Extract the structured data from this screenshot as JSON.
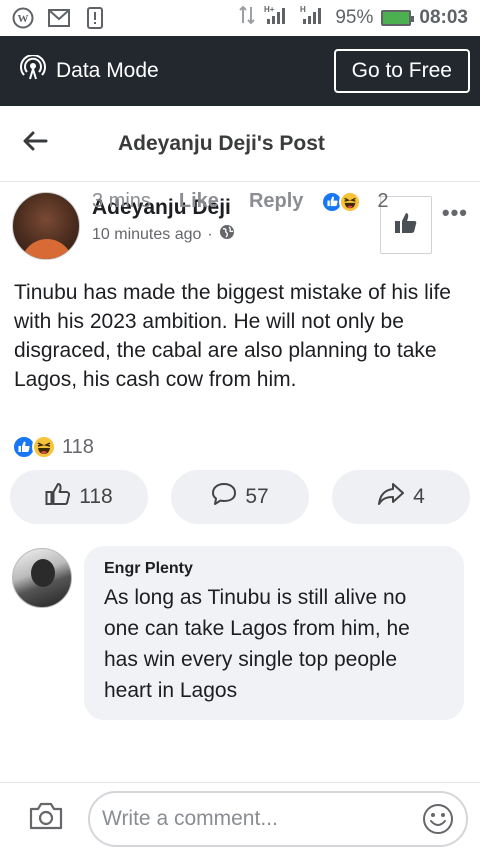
{
  "status_bar": {
    "battery": "95%",
    "time": "08:03",
    "icons": [
      "wordpress-icon",
      "gmail-icon",
      "sim-alert-icon",
      "data-transfer-icon",
      "signal-h-icon",
      "signal-h-icon-2",
      "battery-icon"
    ]
  },
  "data_bar": {
    "mode_label": "Data Mode",
    "cta_label": "Go to Free"
  },
  "header": {
    "title": "Adeyanju Deji's Post"
  },
  "post": {
    "author": "Adeyanju Deji",
    "time": "10 minutes ago",
    "text": "Tinubu has made the biggest mistake of his life with his 2023 ambition. He will not only be disgraced, the cabal are also planning to take Lagos, his cash cow from him.",
    "reactions_count": "118"
  },
  "actions": {
    "like_count": "118",
    "comment_count": "57",
    "share_count": "4"
  },
  "comment": {
    "author": "Engr Plenty",
    "text": "As long as Tinubu is still alive no one can take Lagos from him, he has win every single top people heart in Lagos",
    "time": "3 mins",
    "like_label": "Like",
    "reply_label": "Reply",
    "reactions_count": "2"
  },
  "composer": {
    "placeholder": "Write a comment..."
  },
  "colors": {
    "data_bar_bg": "#23272e",
    "like_blue": "#1877f2",
    "haha_yellow": "#f7c33b",
    "bubble_bg": "#f0f2f5"
  }
}
